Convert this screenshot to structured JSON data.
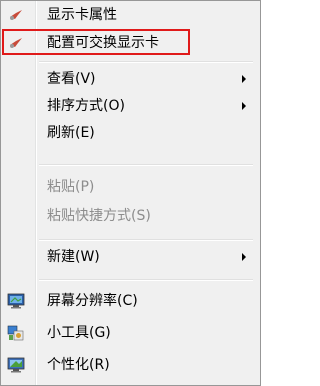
{
  "menu": {
    "items": [
      {
        "label": "显示卡属性",
        "icon": "graphics-properties-icon"
      },
      {
        "label": "配置可交换显示卡",
        "icon": "graphics-switch-icon"
      },
      {
        "label": "查看(V)"
      },
      {
        "label": "排序方式(O)"
      },
      {
        "label": "刷新(E)"
      },
      {
        "label": "粘贴(P)"
      },
      {
        "label": "粘贴快捷方式(S)"
      },
      {
        "label": "新建(W)"
      },
      {
        "label": "屏幕分辨率(C)",
        "icon": "screen-resolution-icon"
      },
      {
        "label": "小工具(G)",
        "icon": "gadgets-icon"
      },
      {
        "label": "个性化(R)",
        "icon": "personalize-icon"
      }
    ]
  },
  "highlight_color": "#e01a1a"
}
